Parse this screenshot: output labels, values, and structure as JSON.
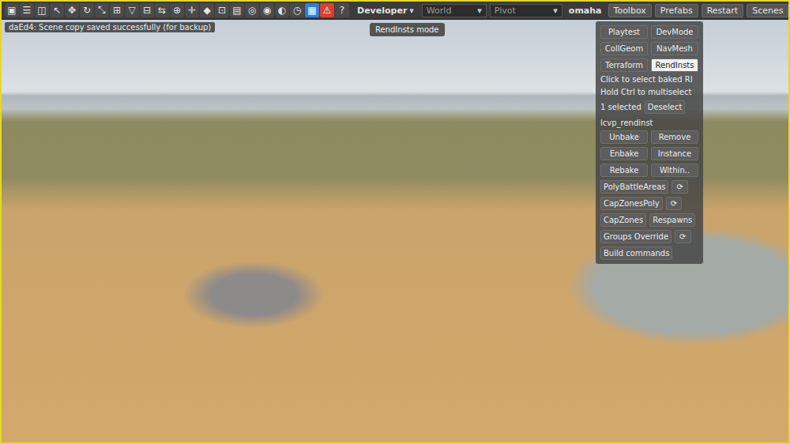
{
  "status_message": "daEd4: Scene copy saved successfully (for backup)",
  "toolbar": {
    "icons": [
      {
        "glyph": "▣",
        "kind": "normal"
      },
      {
        "glyph": "☰",
        "kind": "normal"
      },
      {
        "glyph": "◫",
        "kind": "normal"
      },
      {
        "glyph": "↖",
        "kind": "normal"
      },
      {
        "glyph": "✥",
        "kind": "normal"
      },
      {
        "glyph": "↻",
        "kind": "normal"
      },
      {
        "glyph": "⤡",
        "kind": "normal"
      },
      {
        "glyph": "⊞",
        "kind": "normal"
      },
      {
        "glyph": "▽",
        "kind": "normal"
      },
      {
        "glyph": "⊟",
        "kind": "normal"
      },
      {
        "glyph": "⇆",
        "kind": "normal"
      },
      {
        "glyph": "⊕",
        "kind": "normal"
      },
      {
        "glyph": "✛",
        "kind": "normal"
      },
      {
        "glyph": "◆",
        "kind": "normal"
      },
      {
        "glyph": "⊡",
        "kind": "normal"
      },
      {
        "glyph": "▤",
        "kind": "normal"
      },
      {
        "glyph": "◎",
        "kind": "normal"
      },
      {
        "glyph": "◉",
        "kind": "normal"
      },
      {
        "glyph": "◐",
        "kind": "normal"
      },
      {
        "glyph": "◷",
        "kind": "normal"
      },
      {
        "glyph": "▦",
        "kind": "active"
      },
      {
        "glyph": "⚠",
        "kind": "alert"
      },
      {
        "glyph": "?",
        "kind": "normal"
      }
    ],
    "mode_menu": {
      "label": "Developer",
      "arrow": "▾"
    },
    "fields": [
      {
        "label": "World",
        "arrow": "▾"
      },
      {
        "label": "Pivot",
        "arrow": "▾"
      }
    ],
    "scene": "omaha",
    "buttons": [
      "Toolbox",
      "Prefabs",
      "Restart",
      "Scenes"
    ]
  },
  "mode_tooltip": "RendInsts mode",
  "panel": {
    "mode_buttons": [
      {
        "label": "Playtest",
        "selected": false
      },
      {
        "label": "DevMode",
        "selected": false
      },
      {
        "label": "CollGeom",
        "selected": false
      },
      {
        "label": "NavMesh",
        "selected": false
      },
      {
        "label": "Terraform",
        "selected": false
      },
      {
        "label": "RendInsts",
        "selected": true
      }
    ],
    "hints": [
      "Click to select baked RI",
      "Hold Ctrl to multiselect"
    ],
    "selection": {
      "count": "1 selected",
      "button": "Deselect"
    },
    "object_name": "lcvp_rendinst",
    "ri_buttons": [
      "Unbake",
      "Remove",
      "Enbake",
      "Instance",
      "Rebake",
      "Within.."
    ],
    "tool_rows": [
      [
        {
          "label": "PolyBattleAreas",
          "kind": "button"
        },
        {
          "label": "⟳",
          "kind": "icon"
        }
      ],
      [
        {
          "label": "CapZonesPoly",
          "kind": "button"
        },
        {
          "label": "⟳",
          "kind": "icon"
        }
      ],
      [
        {
          "label": "CapZones",
          "kind": "button"
        },
        {
          "label": "Respawns",
          "kind": "button"
        }
      ],
      [
        {
          "label": "Groups Override",
          "kind": "button"
        },
        {
          "label": "⟳",
          "kind": "icon"
        }
      ],
      [
        {
          "label": "Build commands",
          "kind": "button"
        }
      ]
    ]
  }
}
